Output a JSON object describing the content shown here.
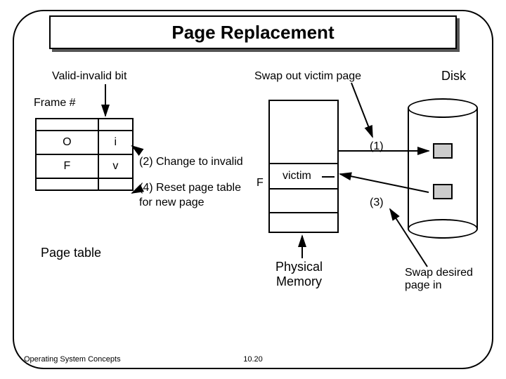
{
  "title": "Page Replacement",
  "labels": {
    "valid_invalid_bit": "Valid-invalid bit",
    "frame_num": "Frame #",
    "swap_out": "Swap out victim page",
    "disk": "Disk",
    "change_invalid": "(2) Change to invalid",
    "reset_table": "(4) Reset page table\nfor new page",
    "page_table": "Page table",
    "victim": "victim",
    "f_label": "F",
    "step1": "(1)",
    "step3": "(3)",
    "phys_mem": "Physical\nMemory",
    "swap_in": "Swap desired\npage in"
  },
  "page_table": {
    "rows": [
      {
        "frame": "O",
        "bit": "i"
      },
      {
        "frame": "F",
        "bit": "v"
      }
    ]
  },
  "footer": {
    "left": "Operating System Concepts",
    "center": "10.20"
  }
}
